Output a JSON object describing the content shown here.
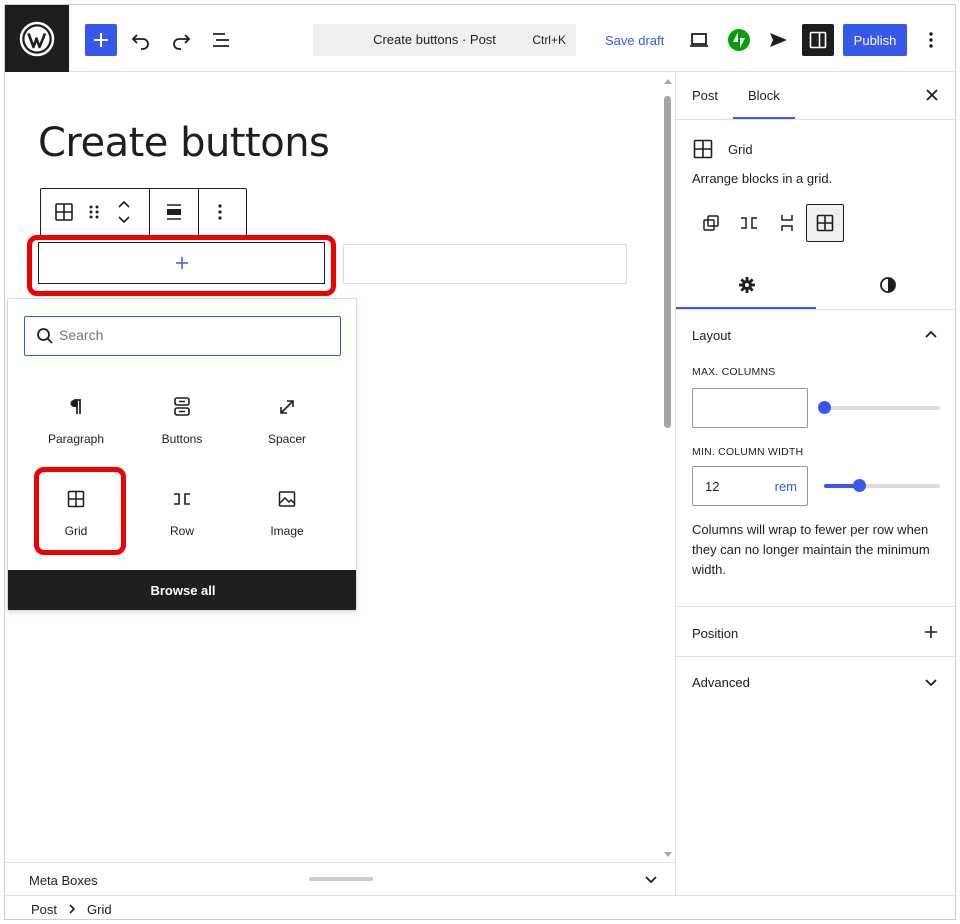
{
  "topbar": {
    "command_title": "Create buttons · Post",
    "command_shortcut": "Ctrl+K",
    "save_draft": "Save draft",
    "publish": "Publish"
  },
  "editor": {
    "post_title": "Create buttons"
  },
  "inserter": {
    "search_placeholder": "Search",
    "blocks": [
      {
        "label": "Paragraph",
        "icon": "paragraph-icon"
      },
      {
        "label": "Buttons",
        "icon": "buttons-icon"
      },
      {
        "label": "Spacer",
        "icon": "spacer-icon"
      },
      {
        "label": "Grid",
        "icon": "grid-icon"
      },
      {
        "label": "Row",
        "icon": "row-icon"
      },
      {
        "label": "Image",
        "icon": "image-icon"
      }
    ],
    "browse_all": "Browse all"
  },
  "sidebar": {
    "tabs": [
      "Post",
      "Block"
    ],
    "active_tab": "Block",
    "block_name": "Grid",
    "block_description": "Arrange blocks in a grid.",
    "layout_title": "Layout",
    "max_columns_label": "MAX. COLUMNS",
    "max_columns_value": "",
    "min_col_width_label": "MIN. COLUMN WIDTH",
    "min_col_width_value": "12",
    "min_col_width_unit": "rem",
    "min_col_width_slider": 0.3,
    "max_columns_slider": 0.0,
    "help_text": "Columns will wrap to fewer per row when they can no longer maintain the minimum width.",
    "position_title": "Position",
    "advanced_title": "Advanced"
  },
  "bottom": {
    "meta_boxes": "Meta Boxes",
    "breadcrumb": [
      "Post",
      "Grid"
    ]
  },
  "colors": {
    "accent": "#3858e9",
    "highlight": "#ee0000",
    "dark": "#1e1e1e",
    "jetpack": "#069e08"
  }
}
